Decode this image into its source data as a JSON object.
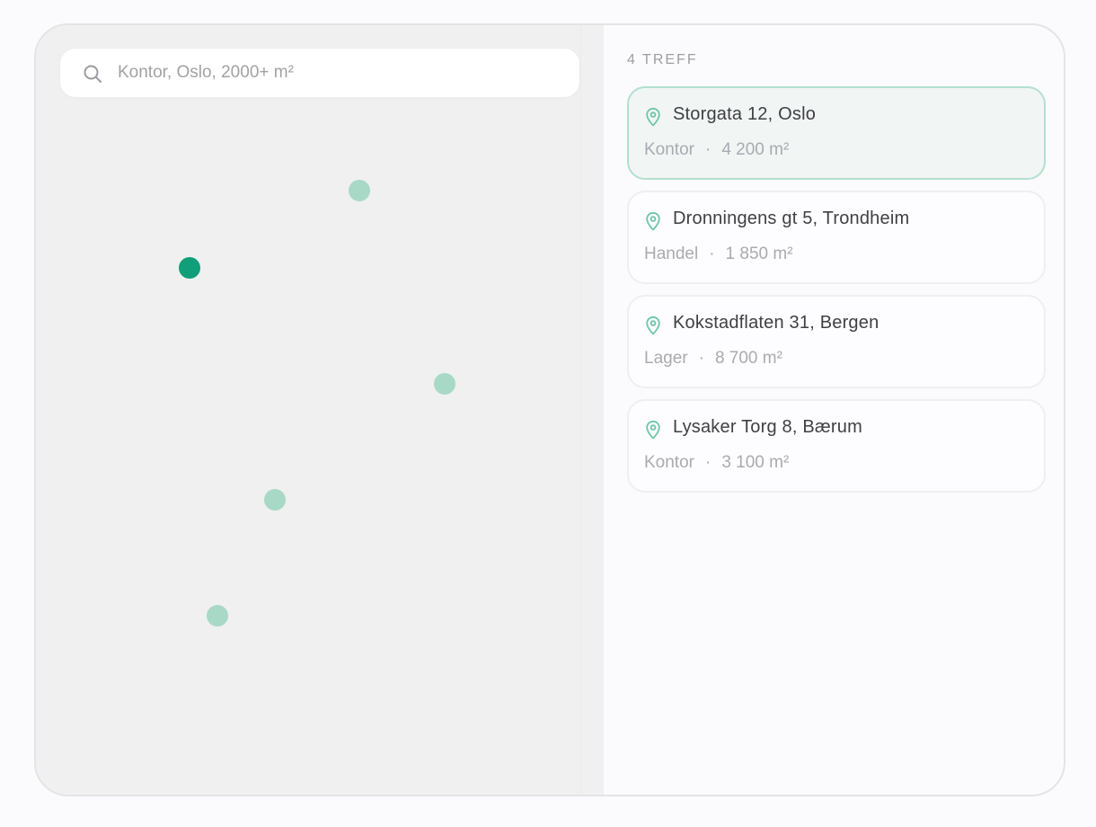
{
  "search": {
    "placeholder": "Kontor, Oslo, 2000+ m²",
    "value": ""
  },
  "colors": {
    "accent": "#109f79",
    "pin_inactive": "#a8d9c7",
    "selected_card_bg": "#f1f5f4",
    "selected_card_border": "#b3e0cf"
  },
  "results": {
    "count_label": "4 TREFF",
    "separator": "·",
    "items": [
      {
        "address": "Storgata 12, Oslo",
        "type": "Kontor",
        "area": "4 200 m²",
        "selected": true
      },
      {
        "address": "Dronningens gt 5, Trondheim",
        "type": "Handel",
        "area": "1 850 m²",
        "selected": false
      },
      {
        "address": "Kokstadflaten 31, Bergen",
        "type": "Lager",
        "area": "8 700 m²",
        "selected": false
      },
      {
        "address": "Lysaker Torg 8, Bærum",
        "type": "Kontor",
        "area": "3 100 m²",
        "selected": false
      }
    ]
  },
  "icons": {
    "search": "search-icon",
    "location": "map-pin-icon"
  }
}
